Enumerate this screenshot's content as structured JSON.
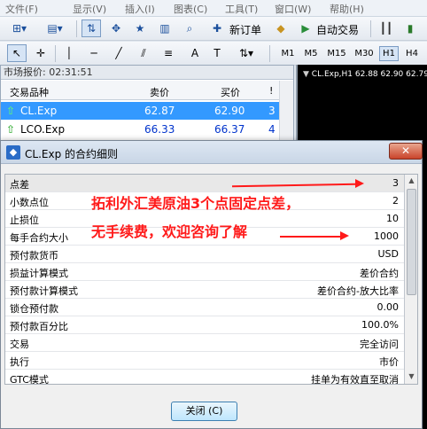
{
  "menu": [
    "文件(F)",
    "显示(V)",
    "插入(I)",
    "图表(C)",
    "工具(T)",
    "窗口(W)",
    "帮助(H)"
  ],
  "toolbar1": {
    "new_order": "新订单",
    "auto_trading": "自动交易"
  },
  "toolbar2": {
    "timeframes": [
      "M1",
      "M5",
      "M15",
      "M30",
      "H1",
      "H4"
    ],
    "active_timeframe": "H1"
  },
  "market_watch": {
    "title": "市场报价: 02:31:51",
    "columns": [
      "交易品种",
      "卖价",
      "买价",
      "!"
    ],
    "rows": [
      {
        "symbol": "CL.Exp",
        "bid": "62.87",
        "ask": "62.90",
        "spread": "3"
      },
      {
        "symbol": "LCO.Exp",
        "bid": "66.33",
        "ask": "66.37",
        "spread": "4"
      }
    ]
  },
  "chart": {
    "title": "CL.Exp,H1  62.88 62.90 62.79"
  },
  "dialog": {
    "title": "CL.Exp 的合约细则",
    "close_icon": "✕",
    "rows": [
      {
        "label": "点差",
        "value": "3"
      },
      {
        "label": "小数点位",
        "value": "2"
      },
      {
        "label": "止损位",
        "value": "10"
      },
      {
        "label": "每手合约大小",
        "value": "1000"
      },
      {
        "label": "预付款货币",
        "value": "USD"
      },
      {
        "label": "损益计算模式",
        "value": "差价合约"
      },
      {
        "label": "预付款计算模式",
        "value": "差价合约-放大比率"
      },
      {
        "label": "锁仓预付款",
        "value": "0.00"
      },
      {
        "label": "预付款百分比",
        "value": "100.0%"
      },
      {
        "label": "交易",
        "value": "完全访问"
      },
      {
        "label": "执行",
        "value": "市价"
      },
      {
        "label": "GTC模式",
        "value": "挂单为有效直至取消"
      }
    ],
    "close_button": "关闭 (C)"
  },
  "annotation": {
    "line1": "拓利外汇美原油3个点固定点差，",
    "line2": "无手续费，欢迎咨询了解",
    "color": "#ff1a1a"
  }
}
